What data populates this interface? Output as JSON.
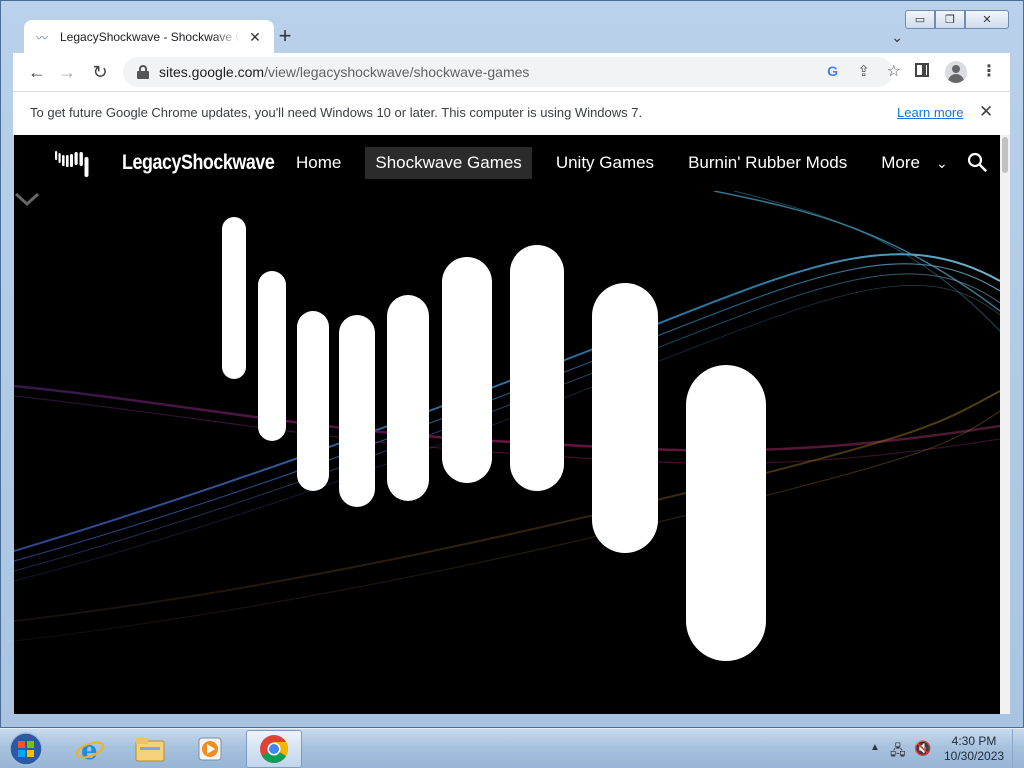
{
  "browser": {
    "tab": {
      "title": "LegacyShockwave - Shockwave Games"
    },
    "url": {
      "host": "sites.google.com",
      "path": "/view/legacyshockwave/shockwave-games"
    },
    "window_controls": {
      "minimize": "▭",
      "restore": "❐",
      "close": "✕"
    }
  },
  "infobar": {
    "message": "To get future Google Chrome updates, you'll need Windows 10 or later. This computer is using Windows 7.",
    "link": "Learn more"
  },
  "site": {
    "name": "LegacyShockwave",
    "nav": [
      {
        "label": "Home"
      },
      {
        "label": "Shockwave Games",
        "active": true
      },
      {
        "label": "Unity Games"
      },
      {
        "label": "Burnin' Rubber Mods"
      },
      {
        "label": "More"
      }
    ]
  },
  "taskbar": {
    "clock": {
      "time": "4:30 PM",
      "date": "10/30/2023"
    },
    "pinned": [
      "internet-explorer",
      "file-explorer",
      "media-player",
      "google-chrome"
    ]
  },
  "icons": {
    "favicon": "shockwave-favicon",
    "search": "search-icon",
    "info": "info-icon",
    "scroll_down": "chevron-down-icon"
  },
  "colors": {
    "page_background": "#000000",
    "link": "#1a73e8",
    "active_nav": "#2b2b2b"
  }
}
